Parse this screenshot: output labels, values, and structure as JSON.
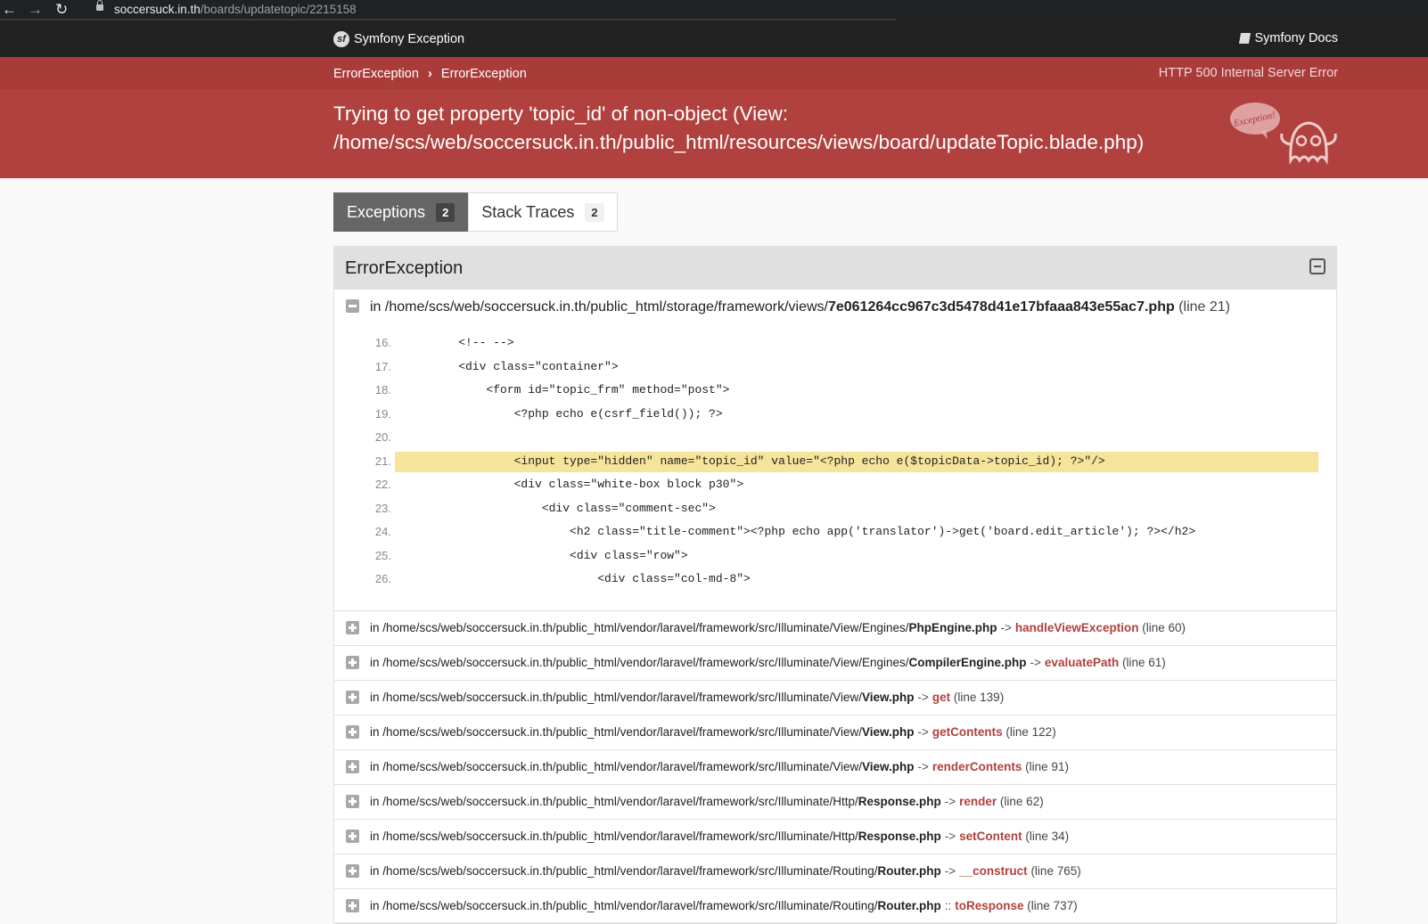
{
  "browser": {
    "url_host": "soccersuck.in.th",
    "url_path": "/boards/updatetopic/2215158"
  },
  "header": {
    "brand": "Symfony Exception",
    "docs": "Symfony Docs",
    "logo_glyph": "sf"
  },
  "breadcrumbs": {
    "items": [
      "ErrorException",
      "ErrorException"
    ],
    "status": "HTTP 500 Internal Server Error"
  },
  "exception_message": "Trying to get property 'topic_id' of non-object (View: /home/scs/web/soccersuck.in.th/public_html/resources/views/board/updateTopic.blade.php)",
  "ghost_label": "Exception!",
  "tabs": [
    {
      "label": "Exceptions",
      "count": "2"
    },
    {
      "label": "Stack Traces",
      "count": "2"
    }
  ],
  "panel": {
    "title": "ErrorException",
    "first_trace": {
      "prefix": "in /home/scs/web/soccersuck.in.th/public_html/storage/framework/views/",
      "file": "7e061264cc967c3d5478d41e17bfaaa843e55ac7.php",
      "line": "(line 21)"
    },
    "code_lines": [
      {
        "num": "16.",
        "code": "    <!-- -->"
      },
      {
        "num": "17.",
        "code": "    <div class=\"container\">"
      },
      {
        "num": "18.",
        "code": "        <form id=\"topic_frm\" method=\"post\">"
      },
      {
        "num": "19.",
        "code": "            <?php echo e(csrf_field()); ?>"
      },
      {
        "num": "20.",
        "code": ""
      },
      {
        "num": "21.",
        "code": "            <input type=\"hidden\" name=\"topic_id\" value=\"<?php echo e($topicData->topic_id); ?>\"/>"
      },
      {
        "num": "22.",
        "code": "            <div class=\"white-box block p30\">"
      },
      {
        "num": "23.",
        "code": "                <div class=\"comment-sec\">"
      },
      {
        "num": "24.",
        "code": "                    <h2 class=\"title-comment\"><?php echo app('translator')->get('board.edit_article'); ?></h2>"
      },
      {
        "num": "25.",
        "code": "                    <div class=\"row\">"
      },
      {
        "num": "26.",
        "code": "                        <div class=\"col-md-8\">"
      }
    ],
    "highlight_line": "21.",
    "traces": [
      {
        "prefix": "in /home/scs/web/soccersuck.in.th/public_html/vendor/laravel/framework/src/Illuminate/View/Engines/",
        "file": "PhpEngine.php",
        "arrow": "->",
        "fn": "handleViewException",
        "line": "(line 60)"
      },
      {
        "prefix": "in /home/scs/web/soccersuck.in.th/public_html/vendor/laravel/framework/src/Illuminate/View/Engines/",
        "file": "CompilerEngine.php",
        "arrow": "->",
        "fn": "evaluatePath",
        "line": "(line 61)"
      },
      {
        "prefix": "in /home/scs/web/soccersuck.in.th/public_html/vendor/laravel/framework/src/Illuminate/View/",
        "file": "View.php",
        "arrow": "->",
        "fn": "get",
        "line": "(line 139)"
      },
      {
        "prefix": "in /home/scs/web/soccersuck.in.th/public_html/vendor/laravel/framework/src/Illuminate/View/",
        "file": "View.php",
        "arrow": "->",
        "fn": "getContents",
        "line": "(line 122)"
      },
      {
        "prefix": "in /home/scs/web/soccersuck.in.th/public_html/vendor/laravel/framework/src/Illuminate/View/",
        "file": "View.php",
        "arrow": "->",
        "fn": "renderContents",
        "line": "(line 91)"
      },
      {
        "prefix": "in /home/scs/web/soccersuck.in.th/public_html/vendor/laravel/framework/src/Illuminate/Http/",
        "file": "Response.php",
        "arrow": "->",
        "fn": "render",
        "line": "(line 62)"
      },
      {
        "prefix": "in /home/scs/web/soccersuck.in.th/public_html/vendor/laravel/framework/src/Illuminate/Http/",
        "file": "Response.php",
        "arrow": "->",
        "fn": "setContent",
        "line": "(line 34)"
      },
      {
        "prefix": "in /home/scs/web/soccersuck.in.th/public_html/vendor/laravel/framework/src/Illuminate/Routing/",
        "file": "Router.php",
        "arrow": "->",
        "fn": "__construct",
        "line": "(line 765)"
      },
      {
        "prefix": "in /home/scs/web/soccersuck.in.th/public_html/vendor/laravel/framework/src/Illuminate/Routing/",
        "file": "Router.php",
        "arrow": "::",
        "fn": "toResponse",
        "line": "(line 737)"
      }
    ]
  },
  "colors": {
    "header_bg": "#222222",
    "breadcrumb_bg": "#a93b39",
    "banner_bg": "#b0413e",
    "highlight": "#f5e49a",
    "function": "#b0413e"
  }
}
